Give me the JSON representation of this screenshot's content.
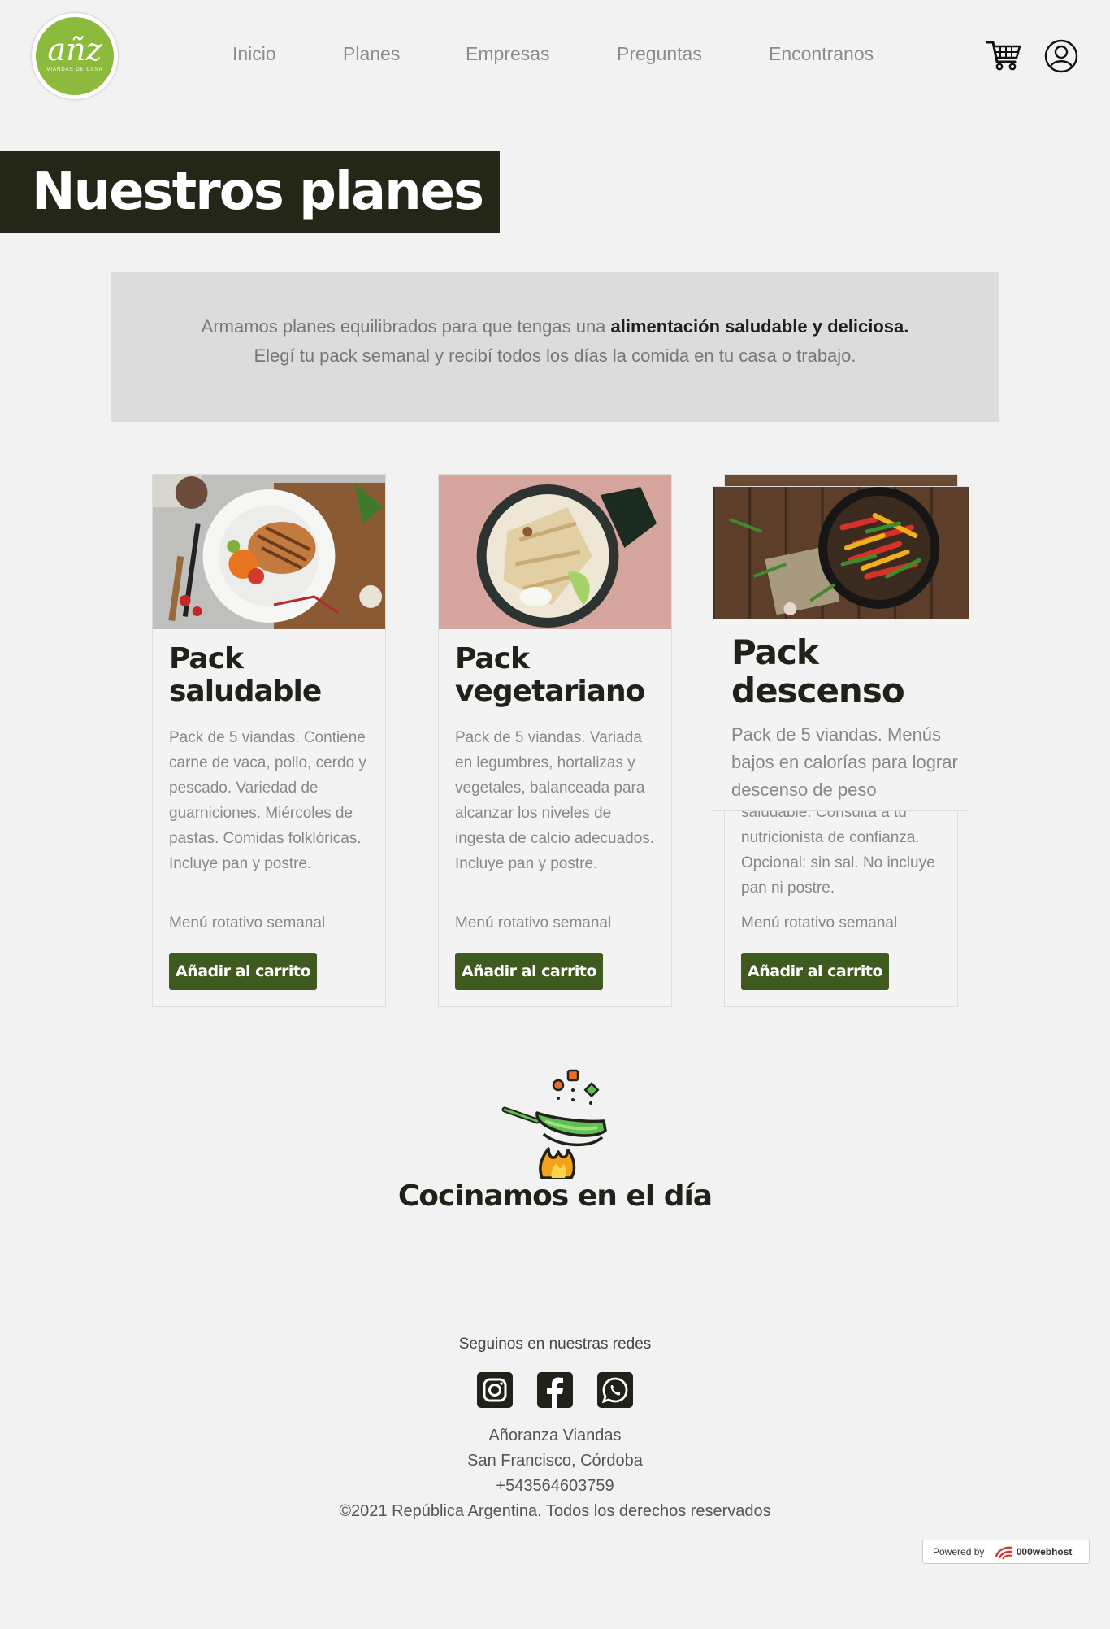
{
  "header": {
    "logo_text": "añz",
    "logo_sub": "VIANDAS DE CASA",
    "nav": [
      "Inicio",
      "Planes",
      "Empresas",
      "Preguntas",
      "Encontranos"
    ],
    "icons": [
      "cart-icon",
      "user-icon"
    ]
  },
  "page_title": "Nuestros planes",
  "intro": {
    "line1_pre": "Armamos planes equilibrados para que tengas una ",
    "line1_bold": "alimentación saludable y deliciosa.",
    "line2": "Elegí tu pack semanal y recibí todos los días la comida en tu casa o trabajo."
  },
  "cards": [
    {
      "title": "Pack saludable",
      "description": "Pack de 5 viandas. Contiene carne de vaca, pollo, cerdo y pescado. Variedad de guarniciones. Miércoles de pastas. Comidas folklóricas. Incluye pan y postre.",
      "menu": "Menú rotativo semanal",
      "button": "Añadir al carrito"
    },
    {
      "title": "Pack vegetariano",
      "description": "Pack de 5 viandas. Variada en legumbres, hortalizas y vegetales, balanceada para alcanzar los niveles de ingesta de calcio adecuados. Incluye pan y postre.",
      "menu": "Menú rotativo semanal",
      "button": "Añadir al carrito"
    },
    {
      "title": "Pack descenso",
      "description_tail": "saludable. Consultá a tu nutricionista de confianza. Opcional: sin sal. No incluye pan ni postre.",
      "menu": "Menú rotativo semanal",
      "button": "Añadir al carrito"
    }
  ],
  "card_zoom": {
    "title": "Pack descenso",
    "description": "Pack de 5 viandas. Menús bajos en calorías para lograr descenso de peso"
  },
  "cook": {
    "title": "Cocinamos en el día"
  },
  "footer": {
    "follow": "Seguinos en nuestras redes",
    "social": [
      "instagram-icon",
      "facebook-icon",
      "whatsapp-icon"
    ],
    "lines": [
      "Añoranza Viandas",
      "San Francisco, Córdoba",
      "+543564603759",
      "©2021 República Argentina. Todos los derechos reservados"
    ],
    "powered_label": "Powered by",
    "powered_brand": "000webhost"
  },
  "colors": {
    "accent": "#3f5a1f",
    "title_band": "#242618",
    "logo": "#8cba3d",
    "background": "#f2f2f2"
  }
}
